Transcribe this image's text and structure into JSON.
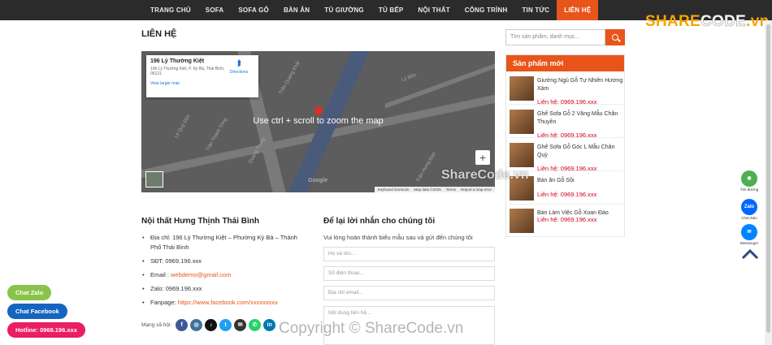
{
  "nav": {
    "items": [
      "TRANG CHỦ",
      "SOFA",
      "SOFA GỖ",
      "BÀN ĂN",
      "TỦ GIƯỜNG",
      "TỦ BẾP",
      "NỘI THẤT",
      "CÔNG TRÌNH",
      "TIN TỨC",
      "LIÊN HỆ"
    ],
    "active": "LIÊN HỆ"
  },
  "logo": {
    "text_a": "SHARE",
    "text_b": "CODE",
    "text_c": ".vn"
  },
  "page_title": "LIÊN HỆ",
  "map": {
    "place_name": "196 Lý Thường Kiệt",
    "place_address": "196 Lý Thường Kiệt, P. Kỳ Bá, Thái Bình, 06121",
    "directions_label": "Directions",
    "larger_map_link": "View larger map",
    "overlay_text": "Use ctrl + scroll to zoom the map",
    "zoom_in": "+",
    "attribution": "Google",
    "footer": [
      "Keyboard shortcuts",
      "Map data ©2025",
      "Terms",
      "Report a map error"
    ],
    "street_labels": [
      "Trần Thánh Tông",
      "Lý Bôn",
      "Trần Quang Khải",
      "Lê Quý Đôn",
      "Quang Trung",
      "Trần Hưng Đạo"
    ]
  },
  "company": {
    "title": "Nội thất Hưng Thịnh Thái Bình",
    "address": "Địa chỉ: 196 Lý Thường Kiệt – Phường Kỳ Bá – Thành Phố Thái Bình",
    "phone": "SĐT: 0969.196.xxx",
    "email_label": "Email : ",
    "email": "webdemo@gmail.com",
    "zalo": "Zalo: 0969.196.xxx",
    "fanpage_label": "Fanpage: ",
    "fanpage": "https://www.facebook.com/xxxxxxxxx",
    "social_label": "Mạng xã hội:"
  },
  "social": [
    {
      "name": "facebook-icon",
      "glyph": "f",
      "color": "#3b5998"
    },
    {
      "name": "instagram-icon",
      "glyph": "◎",
      "color": "#3f729b"
    },
    {
      "name": "tiktok-icon",
      "glyph": "♪",
      "color": "#111111"
    },
    {
      "name": "twitter-icon",
      "glyph": "t",
      "color": "#1da1f2"
    },
    {
      "name": "email-icon",
      "glyph": "✉",
      "color": "#333333"
    },
    {
      "name": "phone-icon",
      "glyph": "✆",
      "color": "#25d366"
    },
    {
      "name": "linkedin-icon",
      "glyph": "in",
      "color": "#0077b5"
    }
  ],
  "form": {
    "title": "Để lại lời nhắn cho chúng tôi",
    "subtitle": "Vui lòng hoàn thành biểu mẫu sau và gửi đến chúng tôi",
    "name_placeholder": "Họ và tên...",
    "phone_placeholder": "Số điện thoại...",
    "email_placeholder": "Địa chỉ email...",
    "message_placeholder": "Nội dung liên hệ..."
  },
  "search": {
    "placeholder": "Tìm sản phẩm, danh mục..."
  },
  "new_products": {
    "title": "Sản phẩm mới",
    "items": [
      {
        "name": "Giường Ngủ Gỗ Tự Nhiên Hương Xám",
        "price": "Liên hệ: 0969.196.xxx"
      },
      {
        "name": "Ghế Sofa Gỗ 2 Văng Mẫu Chân Thuyền",
        "price": "Liên hệ: 0969.196.xxx"
      },
      {
        "name": "Ghế Sofa Gỗ Góc L Mẫu Chân Quỳ",
        "price": "Liên hệ: 0969.196.xxx"
      },
      {
        "name": "Bàn ăn Gỗ Sồi",
        "price": "Liên hệ: 0969.196.xxx"
      },
      {
        "name": "Bàn Làm Việc Gỗ Xoan Đào",
        "price": "Liên hệ: 0969.196.xxx"
      }
    ]
  },
  "floating_right": [
    {
      "name": "map-directions-icon",
      "glyph": "◉",
      "label": "Tìm đường",
      "color": "#4caf50"
    },
    {
      "name": "zalo-icon",
      "glyph": "Zalo",
      "label": "Chat Zalo",
      "color": "#0068ff"
    },
    {
      "name": "messenger-icon",
      "glyph": "✉",
      "label": "Messenger",
      "color": "#0084ff"
    }
  ],
  "floating_left": [
    {
      "label": "Chat Zalo",
      "color": "#8bc34a"
    },
    {
      "label": "Chat Facebook",
      "color": "#1565c0"
    },
    {
      "label": "Hotline: 0969.196.xxx",
      "color": "#e91e63"
    }
  ],
  "watermarks": {
    "center": "ShareCode.vn",
    "bottom": "Copyright © ShareCode.vn"
  }
}
